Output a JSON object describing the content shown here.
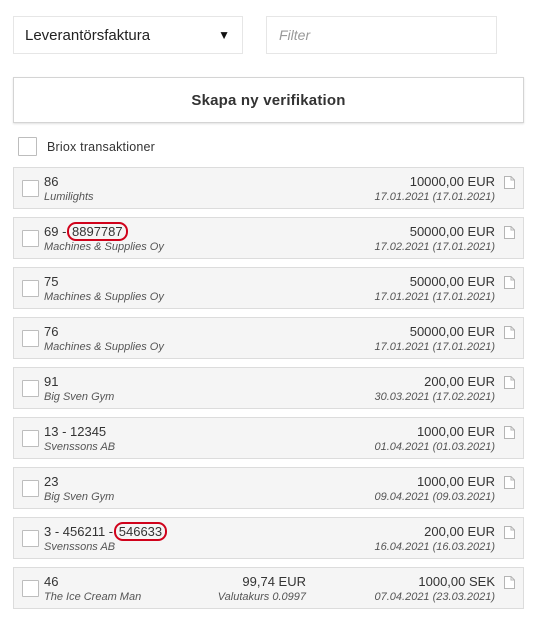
{
  "type_select": {
    "value": "Leverantörsfaktura",
    "icon": "chevron-down-icon"
  },
  "filter": {
    "placeholder": "Filter",
    "value": ""
  },
  "create_button": {
    "label": "Skapa ny verifikation"
  },
  "briox": {
    "label": "Briox transaktioner",
    "checked": false
  },
  "highlight_color": "#d0021b",
  "rows": [
    {
      "num": "86",
      "vendor": "Lumilights",
      "amount": "10000,00 EUR",
      "date": "17.01.2021 (17.01.2021)"
    },
    {
      "num": "69 - ",
      "num_highlight": "8897787",
      "vendor": "Machines & Supplies Oy",
      "amount": "50000,00 EUR",
      "date": "17.02.2021 (17.01.2021)"
    },
    {
      "num": "75",
      "vendor": "Machines & Supplies Oy",
      "amount": "50000,00 EUR",
      "date": "17.01.2021 (17.01.2021)"
    },
    {
      "num": "76",
      "vendor": "Machines & Supplies Oy",
      "amount": "50000,00 EUR",
      "date": "17.01.2021 (17.01.2021)"
    },
    {
      "num": "91",
      "vendor": "Big Sven Gym",
      "amount": "200,00 EUR",
      "date": "30.03.2021 (17.02.2021)"
    },
    {
      "num": "13 - 12345",
      "vendor": "Svenssons AB",
      "amount": "1000,00 EUR",
      "date": "01.04.2021 (01.03.2021)"
    },
    {
      "num": "23",
      "vendor": "Big Sven Gym",
      "amount": "1000,00 EUR",
      "date": "09.04.2021 (09.03.2021)"
    },
    {
      "num": "3 - 456211 - ",
      "num_highlight": "546633",
      "vendor": "Svenssons AB",
      "amount": "200,00 EUR",
      "date": "16.04.2021 (16.03.2021)"
    },
    {
      "num": "46",
      "vendor": "The Ice Cream Man",
      "mid_amount": "99,74 EUR",
      "mid_rate": "Valutakurs 0.0997",
      "amount": "1000,00 SEK",
      "date": "07.04.2021 (23.03.2021)"
    }
  ]
}
